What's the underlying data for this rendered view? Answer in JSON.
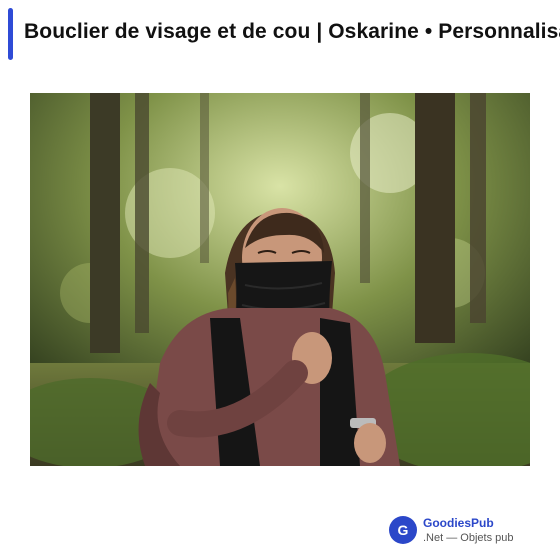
{
  "header": {
    "title": "Bouclier de visage et de cou | Oskarine • Personnalisable"
  },
  "photo": {
    "subject": "woman-running-in-forest-wearing-neck-gaiter"
  },
  "brand": {
    "logo_letter": "G",
    "name": "GoodiesPub",
    "tagline": ".Net — Objets pub"
  },
  "colors": {
    "accent": "#2f4bd6",
    "brand_blue": "#2b47c9"
  }
}
